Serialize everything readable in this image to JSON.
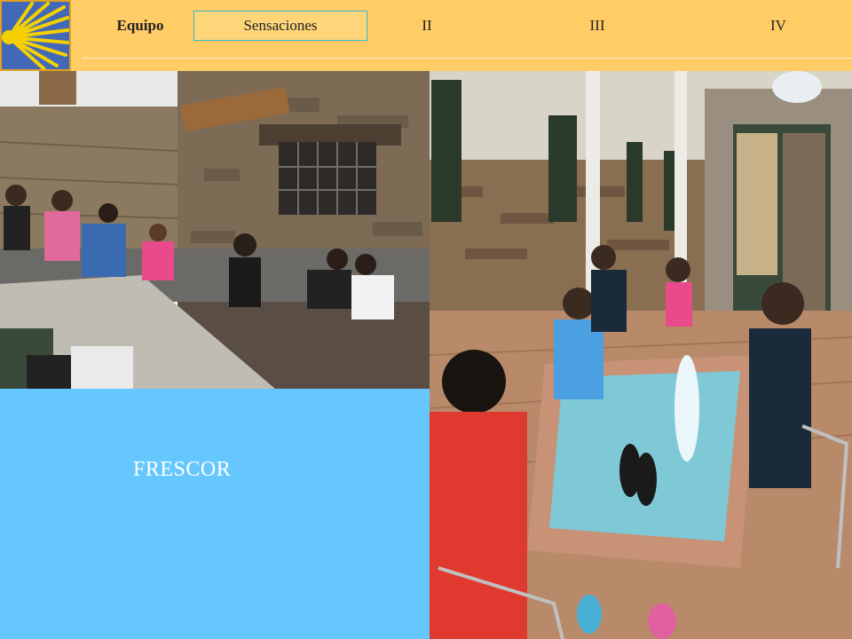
{
  "logo": {
    "icon": "scallop-shell-icon",
    "background": "#4169b8",
    "shell_color": "#f5d000"
  },
  "nav": {
    "items": [
      {
        "label": "Equipo",
        "active": false
      },
      {
        "label": "Sensaciones",
        "active": true
      },
      {
        "label": "II",
        "active": false
      },
      {
        "label": "III",
        "active": false
      },
      {
        "label": "IV",
        "active": false
      }
    ]
  },
  "photos": {
    "left": {
      "description_icon": "photo-group-at-fountain"
    },
    "right": {
      "description_icon": "photo-feet-in-fountain"
    }
  },
  "caption": {
    "text": "FRESCOR"
  },
  "colors": {
    "topbar": "#ffcc66",
    "caption_panel": "#66c7ff",
    "caption_text": "#ffffff"
  }
}
